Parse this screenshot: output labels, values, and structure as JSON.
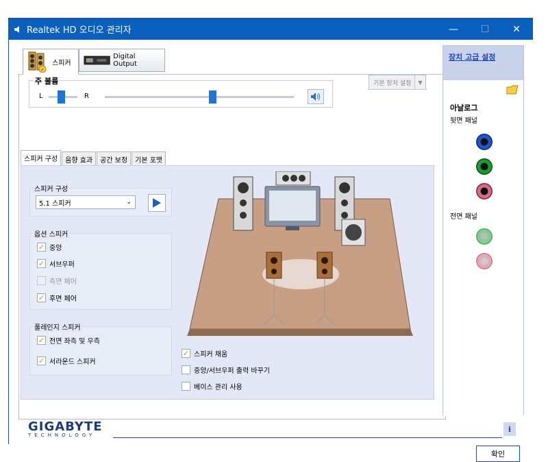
{
  "window": {
    "title": "Realtek HD 오디오 관리자"
  },
  "tabs": {
    "speaker": "스피커",
    "digital": "Digital Output"
  },
  "volume": {
    "legend": "주 볼륨",
    "left": "L",
    "right": "R",
    "default_device_btn": "기본 장치 설정"
  },
  "sub_tabs": [
    "스피커 구성",
    "음향 효과",
    "공간 보정",
    "기본 포맷"
  ],
  "speaker_config": {
    "legend": "스피커 구성",
    "selected": "5.1 스피커"
  },
  "optional": {
    "legend": "옵션 스피커",
    "center": "중앙",
    "subwoofer": "서브우퍼",
    "side_pair": "측면 페어",
    "rear_pair": "후면 페어"
  },
  "fullrange": {
    "legend": "풀레인지 스피커",
    "front": "전면 좌측 및 우측",
    "surround": "서라운드 스피커"
  },
  "bottom_opts": {
    "fill": "스피커 채움",
    "swap": "중앙/서브우퍼 출력 바꾸기",
    "bass": "베이스 관리 사용"
  },
  "right": {
    "advanced": "장치 고급 설정",
    "analog": "아날로그",
    "rear_panel": "뒷면 패널",
    "front_panel": "전면 패널"
  },
  "footer": {
    "brand": "GIGABYTE",
    "brand_sub": "TECHNOLOGY",
    "ok": "확인"
  },
  "colors": {
    "accent": "#0b5fbd",
    "check": "#e58a12"
  }
}
